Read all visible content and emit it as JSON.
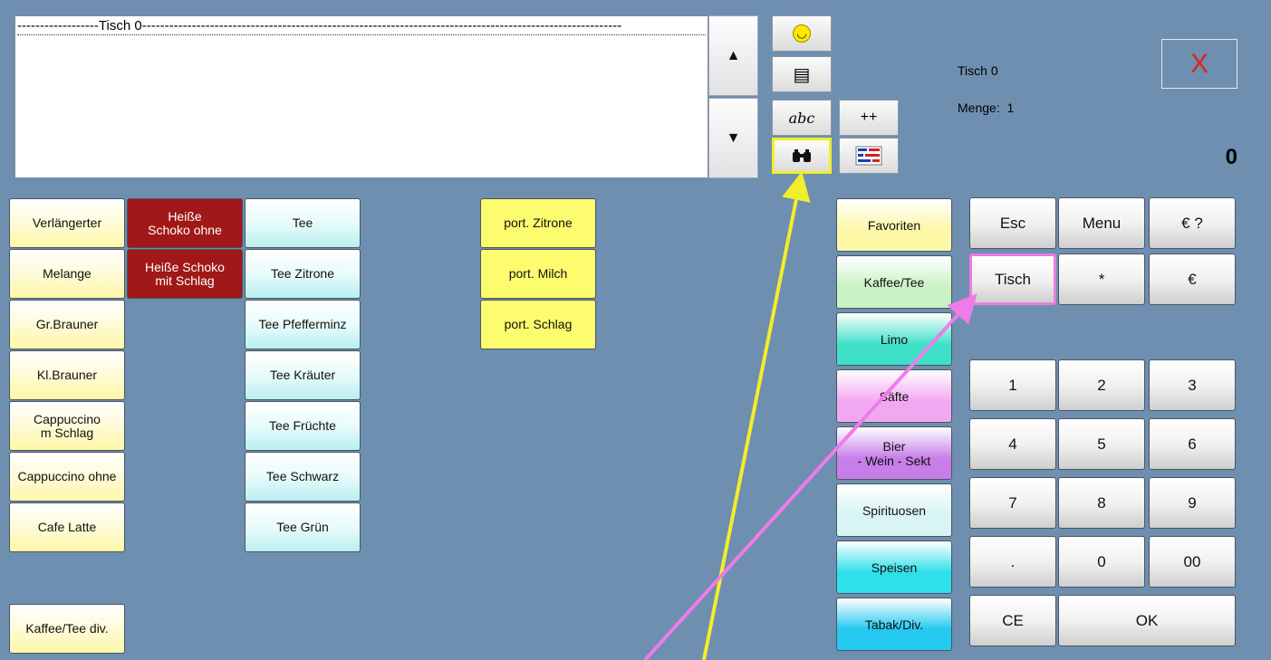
{
  "order": {
    "header_line": "------------------Tisch 0----------------------------------------------------------------------------------------------------------"
  },
  "scroll": {
    "up": "▲",
    "down": "▼"
  },
  "tools": {
    "smiley": "☺",
    "receipt": "▤",
    "abc": "abc",
    "plusplus": "++",
    "binoculars": "⊷",
    "flag": "≡"
  },
  "info": {
    "table": "Tisch 0",
    "qty_label": "Menge:",
    "qty_value": "1",
    "total": "0",
    "close": "X"
  },
  "products": {
    "col1": [
      "Verlängerter",
      "Melange",
      "Gr.Brauner",
      "Kl.Brauner",
      "Cappuccino\nm Schlag",
      "Cappuccino ohne",
      "Cafe Latte"
    ],
    "col2": [
      "Heiße\nSchoko ohne",
      "Heiße Schoko\nmit Schlag"
    ],
    "col3": [
      "Tee",
      "Tee Zitrone",
      "Tee Pfefferminz",
      "Tee Kräuter",
      "Tee Früchte",
      "Tee Schwarz",
      "Tee Grün"
    ],
    "col4": [
      "port. Zitrone",
      "port. Milch",
      "port. Schlag"
    ],
    "misc": "Kaffee/Tee div."
  },
  "categories": [
    {
      "label": "Favoriten",
      "color": "#fdf7a8"
    },
    {
      "label": "Kaffee/Tee",
      "color": "#c9f2c6"
    },
    {
      "label": "Limo",
      "color": "#3fe0c8"
    },
    {
      "label": "Säfte",
      "color": "#f2a8f0"
    },
    {
      "label": "Bier\n- Wein - Sekt",
      "color": "#c77ee9"
    },
    {
      "label": "Spirituosen",
      "color": "#d8f4f4"
    },
    {
      "label": "Speisen",
      "color": "#2ee0ea"
    },
    {
      "label": "Tabak/Div.",
      "color": "#25c9ef"
    }
  ],
  "keypad": {
    "row1": [
      "Esc",
      "Menu",
      "€ ?"
    ],
    "row2": [
      "Tisch",
      "*",
      "€"
    ],
    "digits": [
      "1",
      "2",
      "3",
      "4",
      "5",
      "6",
      "7",
      "8",
      "9",
      ".",
      "0",
      "00"
    ],
    "ce": "CE",
    "ok": "OK"
  },
  "colors": {
    "background": "#6e8fb0",
    "yellow_arrow": "#f2ee2a",
    "pink_arrow": "#ee7ce8"
  }
}
